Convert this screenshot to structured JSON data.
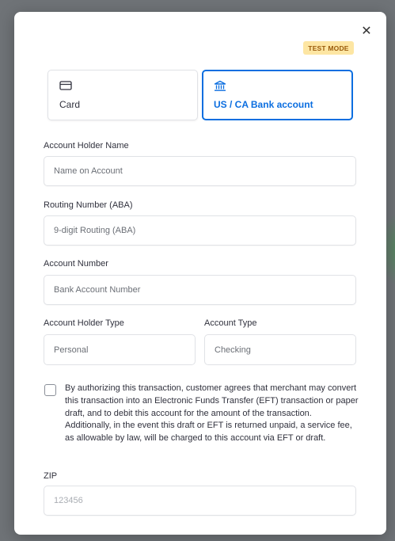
{
  "modal": {
    "close_symbol": "✕",
    "badge": "TEST MODE"
  },
  "tabs": [
    {
      "label": "Card",
      "icon": "card-icon",
      "selected": false
    },
    {
      "label": "US / CA Bank account",
      "icon": "bank-icon",
      "selected": true
    }
  ],
  "form": {
    "account_holder_name": {
      "label": "Account Holder Name",
      "placeholder": "Name on Account",
      "value": ""
    },
    "routing_number": {
      "label": "Routing Number (ABA)",
      "placeholder": "9-digit Routing (ABA)",
      "value": ""
    },
    "account_number": {
      "label": "Account Number",
      "placeholder": "Bank Account Number",
      "value": ""
    },
    "account_holder_type": {
      "label": "Account Holder Type",
      "selected": "Personal"
    },
    "account_type": {
      "label": "Account Type",
      "selected": "Checking"
    },
    "authorization": {
      "checked": false,
      "text": "By authorizing this transaction, customer agrees that merchant may convert this transaction into an Electronic Funds Transfer (EFT) transaction or paper draft, and to debit this account for the amount of the transaction. Additionally, in the event this draft or EFT is returned unpaid, a service fee, as allowable by law, will be charged to this account via EFT or draft."
    },
    "zip": {
      "label": "ZIP",
      "placeholder": "123456",
      "value": ""
    }
  },
  "colors": {
    "accent": "#0b6ee0",
    "badge_bg": "#fde6a3",
    "badge_text": "#9a5a0a",
    "backdrop": "#6f7377"
  }
}
